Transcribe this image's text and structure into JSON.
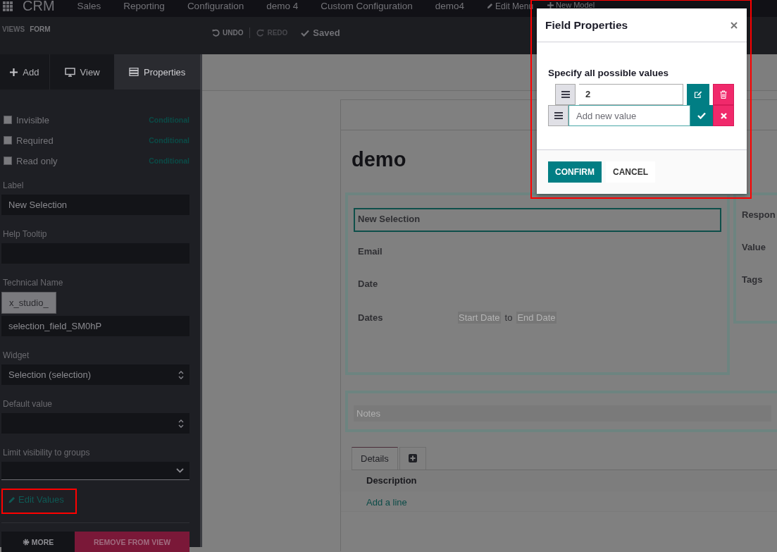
{
  "navbar": {
    "app": "CRM",
    "menus": [
      "Sales",
      "Reporting",
      "Configuration",
      "demo 4",
      "Custom Configuration",
      "demo4"
    ],
    "studio_items": [
      {
        "label": "Edit Menu",
        "kind": "edit"
      },
      {
        "label": "New Model",
        "kind": "add"
      }
    ]
  },
  "breadcrumb": [
    "VIEWS",
    "FORM"
  ],
  "history": {
    "undo": {
      "label": "UNDO",
      "disabled": false
    },
    "redo": {
      "label": "REDO",
      "disabled": true
    },
    "status": "Saved"
  },
  "sidebar": {
    "tabs": [
      {
        "label": "Add",
        "kind": "plus",
        "selected": false
      },
      {
        "label": "View",
        "kind": "monitor",
        "selected": false
      },
      {
        "label": "Properties",
        "kind": "server",
        "selected": true
      }
    ],
    "flags": [
      {
        "label": "Invisible",
        "checked": false,
        "link": "Conditional"
      },
      {
        "label": "Required",
        "checked": false,
        "link": "Conditional"
      },
      {
        "label": "Read only",
        "checked": false,
        "link": "Conditional"
      }
    ],
    "fields": [
      {
        "label": "Label",
        "kind": "text",
        "value": "New Selection"
      },
      {
        "label": "Help Tooltip",
        "kind": "text"
      },
      {
        "label": "Technical Name",
        "kind": "prefixed",
        "prefix": "x_studio_",
        "value": "selection_field_SM0hP"
      },
      {
        "label": "Widget",
        "kind": "select",
        "value": "Selection (selection)"
      },
      {
        "label": "Default value",
        "kind": "select"
      },
      {
        "label": "Limit visibility to groups",
        "kind": "dropdown"
      }
    ],
    "edit_values": {
      "label": "Edit Values",
      "highlighted": true
    },
    "buttons": [
      {
        "label": "MORE",
        "kind": "more"
      },
      {
        "label": "REMOVE FROM VIEW",
        "kind": "danger"
      }
    ]
  },
  "form": {
    "title": "demo",
    "left_fields": [
      {
        "label": "New Selection",
        "kind": "field",
        "selected": true
      },
      {
        "label": "Email",
        "kind": "field",
        "selected": false
      },
      {
        "label": "Date",
        "kind": "field",
        "selected": false
      },
      {
        "label": "Dates",
        "kind": "range",
        "selected": false,
        "start_placeholder": "Start Date",
        "separator": "to",
        "end_placeholder": "End Date"
      }
    ],
    "right_fields": [
      "Respon",
      "Value",
      "Tags"
    ],
    "notes_placeholder": "Notes",
    "tabs": [
      {
        "label": "Details",
        "kind": "text",
        "selected": true
      },
      {
        "kind": "add",
        "selected": false
      }
    ],
    "columns": [
      "Description"
    ],
    "add_line": "Add a line"
  },
  "dialog": {
    "title": "Field Properties",
    "highlighted": true,
    "prompt": "Specify all possible values",
    "values": [
      {
        "kind": "saved",
        "value": "2"
      },
      {
        "kind": "new",
        "placeholder": "Add new value"
      }
    ],
    "buttons": [
      {
        "label": "CONFIRM",
        "kind": "primary"
      },
      {
        "label": "CANCEL",
        "kind": "secondary"
      }
    ]
  }
}
